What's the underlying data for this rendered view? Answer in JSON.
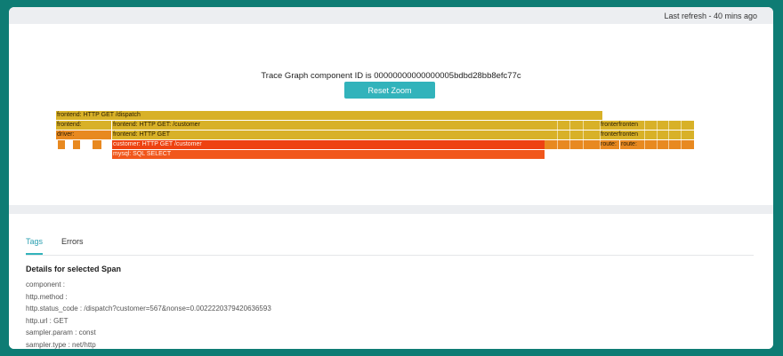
{
  "header": {
    "last_refresh": "Last refresh - 40 mins ago"
  },
  "graph": {
    "title_prefix": "Trace Graph component ID is",
    "component_id": "00000000000000005bdbd28bb8efc77c",
    "reset_zoom_label": "Reset Zoom",
    "spans": {
      "root": "frontend: HTTP GET /dispatch",
      "frontend_left": "frontend:",
      "frontend_customer": "frontend: HTTP GET: /customer",
      "driver": "driver:",
      "frontend_http_get": "frontend: HTTP GET",
      "customer": "customer: HTTP GET /customer",
      "mysql": "mysql: SQL SELECT",
      "fronter_a": "fronterfronten",
      "fronter_b": "fronterfronten",
      "route_a": "route:",
      "route_b": "route:"
    },
    "colors": {
      "frontend": "#d8b128",
      "driver": "#e88920",
      "customer": "#ee4211",
      "mysql": "#f1571c",
      "accent": "#32b3bb"
    }
  },
  "details": {
    "tabs": [
      {
        "label": "Tags",
        "active": true
      },
      {
        "label": "Errors",
        "active": false
      }
    ],
    "heading": "Details for selected Span",
    "tags": [
      "component :",
      "http.method :",
      "http.status_code : /dispatch?customer=567&nonse=0.0022220379420636593",
      "http.url : GET",
      "sampler.param : const",
      "sampler.type : net/http"
    ]
  }
}
